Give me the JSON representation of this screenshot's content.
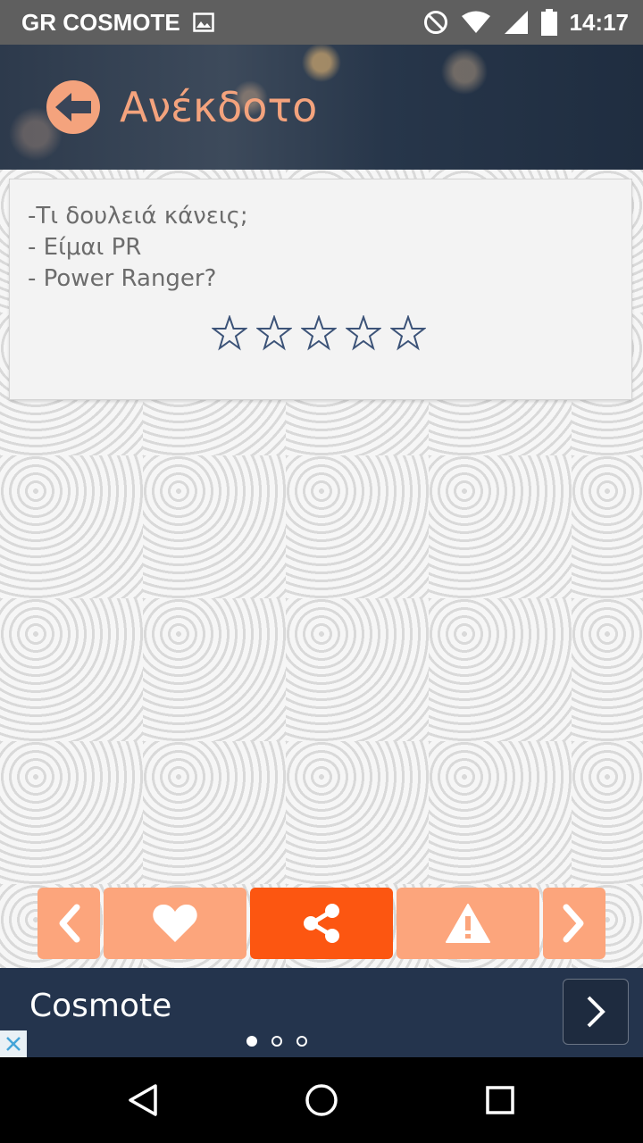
{
  "status_bar": {
    "carrier": "GR COSMOTE",
    "time": "14:17",
    "icons": [
      "image-icon",
      "do-not-disturb-icon",
      "wifi-icon",
      "signal-icon",
      "battery-icon"
    ]
  },
  "header": {
    "title": "Ανέκδοτο",
    "accent_color": "#f4a37d",
    "back_icon": "arrow-left-icon"
  },
  "joke": {
    "lines": [
      "-Τι δουλειά κάνεις;",
      "- Είμαι PR",
      "- Power Ranger?"
    ],
    "rating": {
      "filled": 0,
      "max": 5,
      "star_color": "#3c5378"
    }
  },
  "actions": {
    "colors": {
      "default": "#fca57c",
      "primary": "#fc5611"
    },
    "items": [
      {
        "name": "previous",
        "icon": "chevron-left-icon"
      },
      {
        "name": "favorite",
        "icon": "heart-icon"
      },
      {
        "name": "share",
        "icon": "share-icon"
      },
      {
        "name": "report",
        "icon": "warning-icon"
      },
      {
        "name": "next",
        "icon": "chevron-right-icon"
      }
    ]
  },
  "ad": {
    "title": "Cosmote",
    "background": "#24344d",
    "pages": 3,
    "active_page": 1,
    "next_icon": "chevron-right-icon",
    "close_icon": "close-icon"
  },
  "nav_bar": {
    "icons": [
      "back-triangle-icon",
      "home-circle-icon",
      "recents-square-icon"
    ]
  }
}
